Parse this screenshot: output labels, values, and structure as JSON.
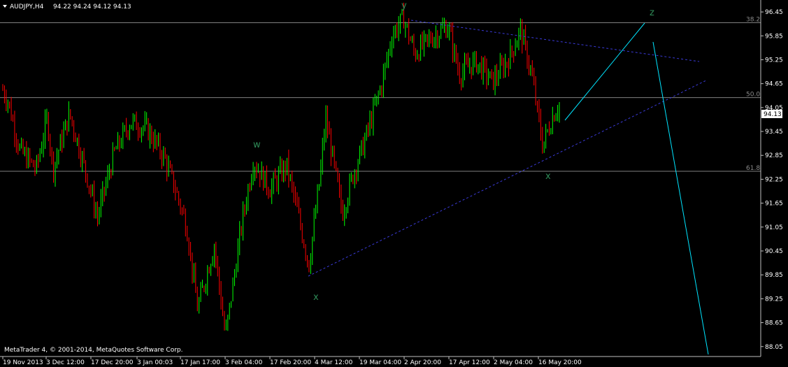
{
  "header": {
    "symbol": "AUDJPY,H4",
    "ohlc": "94.22 94.24 94.12 94.13"
  },
  "copyright": "MetaTrader 4, © 2001-2014, MetaQuotes Software Corp.",
  "price_marker": "94.13",
  "colors": {
    "background": "#000000",
    "bull": "#00ff00",
    "bear": "#ff0000",
    "axis": "#c0c0c0",
    "fib_line": "#808080",
    "triangle": "#3a3ad8",
    "wave_line": "#00e5ff",
    "wave_label": "#2e8b57"
  },
  "chart_data": {
    "type": "candlestick",
    "title": "AUDJPY,H4",
    "ylim": [
      87.8,
      96.75
    ],
    "y_ticks": [
      "96.45",
      "95.85",
      "95.25",
      "94.65",
      "94.05",
      "93.45",
      "92.85",
      "92.25",
      "91.65",
      "91.05",
      "90.45",
      "89.85",
      "89.25",
      "88.65",
      "88.05"
    ],
    "x_ticks": [
      "19 Nov 2013",
      "3 Dec 12:00",
      "17 Dec 20:00",
      "3 Jan 00:03",
      "17 Jan 17:00",
      "3 Feb 04:00",
      "17 Feb 20:00",
      "4 Mar 12:00",
      "19 Mar 04:00",
      "2 Apr 20:00",
      "17 Apr 12:00",
      "2 May 04:00",
      "16 May 20:00"
    ],
    "series_anchors": [
      {
        "t": 0,
        "p": 94.5
      },
      {
        "t": 0.01,
        "p": 94.2
      },
      {
        "t": 0.03,
        "p": 93.0
      },
      {
        "t": 0.06,
        "p": 92.5
      },
      {
        "t": 0.08,
        "p": 93.8
      },
      {
        "t": 0.09,
        "p": 92.5
      },
      {
        "t": 0.12,
        "p": 93.9
      },
      {
        "t": 0.15,
        "p": 92.4
      },
      {
        "t": 0.17,
        "p": 91.3
      },
      {
        "t": 0.2,
        "p": 92.9
      },
      {
        "t": 0.23,
        "p": 93.7
      },
      {
        "t": 0.26,
        "p": 93.5
      },
      {
        "t": 0.29,
        "p": 92.8
      },
      {
        "t": 0.31,
        "p": 92.0
      },
      {
        "t": 0.33,
        "p": 91.1
      },
      {
        "t": 0.35,
        "p": 89.0
      },
      {
        "t": 0.38,
        "p": 90.6
      },
      {
        "t": 0.4,
        "p": 88.3
      },
      {
        "t": 0.43,
        "p": 91.2
      },
      {
        "t": 0.45,
        "p": 92.7
      },
      {
        "t": 0.48,
        "p": 92.0
      },
      {
        "t": 0.51,
        "p": 92.6
      },
      {
        "t": 0.53,
        "p": 91.4
      },
      {
        "t": 0.55,
        "p": 90.1
      },
      {
        "t": 0.57,
        "p": 92.3
      },
      {
        "t": 0.58,
        "p": 93.8
      },
      {
        "t": 0.6,
        "p": 92.2
      },
      {
        "t": 0.61,
        "p": 91.4
      },
      {
        "t": 0.63,
        "p": 92.4
      },
      {
        "t": 0.65,
        "p": 93.2
      },
      {
        "t": 0.68,
        "p": 94.6
      },
      {
        "t": 0.7,
        "p": 95.9
      },
      {
        "t": 0.72,
        "p": 96.3
      },
      {
        "t": 0.74,
        "p": 95.4
      },
      {
        "t": 0.77,
        "p": 95.8
      },
      {
        "t": 0.8,
        "p": 96.1
      },
      {
        "t": 0.82,
        "p": 94.9
      },
      {
        "t": 0.85,
        "p": 95.2
      },
      {
        "t": 0.88,
        "p": 94.7
      },
      {
        "t": 0.91,
        "p": 95.3
      },
      {
        "t": 0.93,
        "p": 96.0
      },
      {
        "t": 0.95,
        "p": 94.9
      },
      {
        "t": 0.97,
        "p": 93.1
      },
      {
        "t": 0.99,
        "p": 93.9
      },
      {
        "t": 1.0,
        "p": 94.13
      }
    ],
    "fibonacci": [
      {
        "label": "38.2",
        "price": 96.18
      },
      {
        "label": "50.0",
        "price": 94.3
      },
      {
        "label": "61.8",
        "price": 92.45
      }
    ],
    "wave_labels": [
      {
        "text": "w",
        "price": 93.35
      },
      {
        "text": "x",
        "price": 89.55
      },
      {
        "text": "y",
        "price": 96.9
      },
      {
        "text": "x",
        "price": 92.3
      },
      {
        "text": "z",
        "price": 96.8
      }
    ],
    "current_price": 94.13
  }
}
